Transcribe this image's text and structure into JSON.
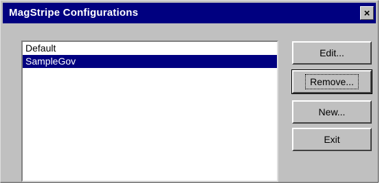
{
  "window": {
    "title": "MagStripe Configurations",
    "close_glyph": "×",
    "title_bar_color": "#000080",
    "face_color": "#c0c0c0"
  },
  "configurations": {
    "items": [
      {
        "label": "Default",
        "selected": false
      },
      {
        "label": "SampleGov",
        "selected": true
      }
    ]
  },
  "buttons": {
    "edit": "Edit...",
    "remove": "Remove...",
    "new": "New...",
    "exit": "Exit"
  },
  "icons": {
    "close": "close-icon"
  }
}
